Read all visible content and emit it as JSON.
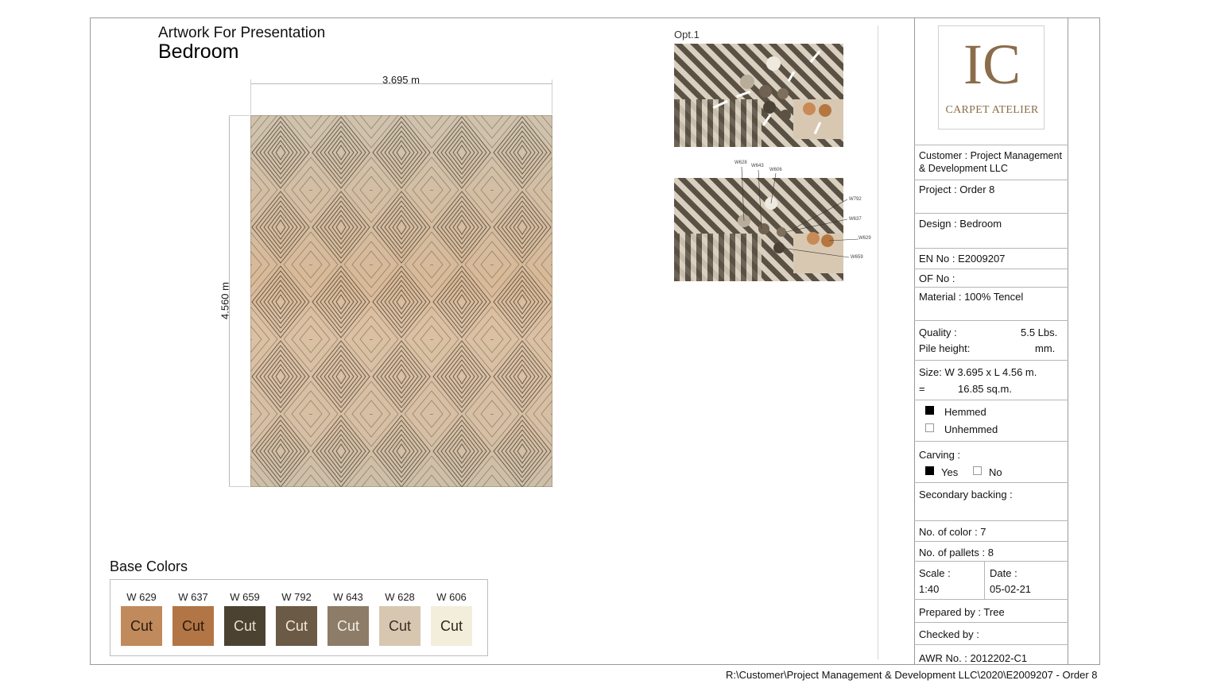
{
  "header": {
    "title": "Artwork For Presentation",
    "subtitle": "Bedroom"
  },
  "dimensions": {
    "width": "3.695 m",
    "height": "4.560 m"
  },
  "samples": {
    "option_label": "Opt.1",
    "callouts": [
      "W628",
      "W643",
      "W606",
      "W792",
      "W637",
      "W629",
      "W659"
    ]
  },
  "base_colors": {
    "title": "Base Colors",
    "swatches": [
      {
        "code": "W 629",
        "label": "Cut",
        "color": "#c08a5c",
        "text_color": "#2a1a0f"
      },
      {
        "code": "W 637",
        "label": "Cut",
        "color": "#b27545",
        "text_color": "#2a1a0f"
      },
      {
        "code": "W 659",
        "label": "Cut",
        "color": "#4b4232",
        "text_color": "#e6e0d2"
      },
      {
        "code": "W 792",
        "label": "Cut",
        "color": "#6b5a45",
        "text_color": "#efe8da"
      },
      {
        "code": "W 643",
        "label": "Cut",
        "color": "#8c7c68",
        "text_color": "#f4efe4"
      },
      {
        "code": "W 628",
        "label": "Cut",
        "color": "#d7c7b1",
        "text_color": "#3a2e22"
      },
      {
        "code": "W 606",
        "label": "Cut",
        "color": "#f3eedc",
        "text_color": "#2d261c"
      }
    ]
  },
  "logo": {
    "mark": "IC",
    "text": "CARPET ATELIER",
    "color": "#8a6d4a"
  },
  "info": {
    "customer_line1": "Customer : Project Management",
    "customer_line2": "& Development LLC",
    "project": "Project : Order 8",
    "design": "Design : Bedroom",
    "en_no": "EN No : E2009207",
    "of_no": "OF No :",
    "material": "Material : 100% Tencel",
    "quality_label": "Quality :",
    "quality_value": "5.5 Lbs.",
    "pile_label": "Pile height:",
    "pile_value": "mm.",
    "size_line1": "Size: W  3.695  x L 4.56 m.",
    "size_eq": "=",
    "size_line2": "16.85 sq.m.",
    "hemmed": "Hemmed",
    "unhemmed": "Unhemmed",
    "hemmed_checked": true,
    "carving_label": "Carving :",
    "carving_yes": "Yes",
    "carving_no": "No",
    "carving_checked": "yes",
    "secondary_backing": "Secondary backing :",
    "no_of_color": "No. of color :  7",
    "no_of_pallets": "No. of pallets : 8",
    "scale_label": "Scale :",
    "scale_value": "1:40",
    "date_label": "Date :",
    "date_value": "05-02-21",
    "prepared_by": "Prepared by : Tree",
    "checked_by": "Checked by :",
    "awr_no": "AWR No. : 2012202-C1"
  },
  "footer": {
    "path": "R:\\Customer\\Project Management & Development LLC\\2020\\E2009207 - Order 8"
  }
}
